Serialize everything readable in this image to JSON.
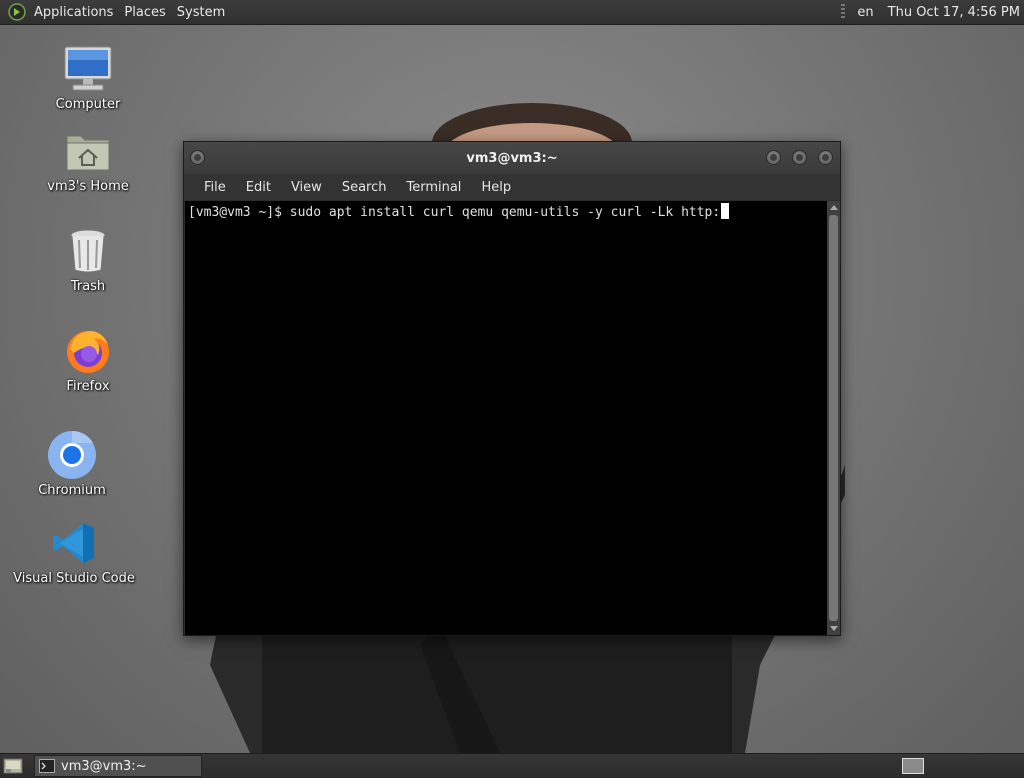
{
  "top_panel": {
    "menus": [
      "Applications",
      "Places",
      "System"
    ],
    "language": "en",
    "clock": "Thu Oct 17,  4:56 PM"
  },
  "desktop_icons": [
    {
      "label": "Computer",
      "icon": "computer-icon"
    },
    {
      "label": "vm3's Home",
      "icon": "home-folder-icon"
    },
    {
      "label": "Trash",
      "icon": "trash-icon"
    },
    {
      "label": "Firefox",
      "icon": "firefox-icon"
    },
    {
      "label": "Chromium",
      "icon": "chromium-icon"
    },
    {
      "label": "Visual Studio Code",
      "icon": "vscode-icon"
    }
  ],
  "terminal": {
    "title": "vm3@vm3:~",
    "menu": [
      "File",
      "Edit",
      "View",
      "Search",
      "Terminal",
      "Help"
    ],
    "prompt_line": "[vm3@vm3 ~]$ sudo apt install curl qemu qemu-utils -y curl -Lk http:"
  },
  "bottom_panel": {
    "task_label": "vm3@vm3:~"
  }
}
